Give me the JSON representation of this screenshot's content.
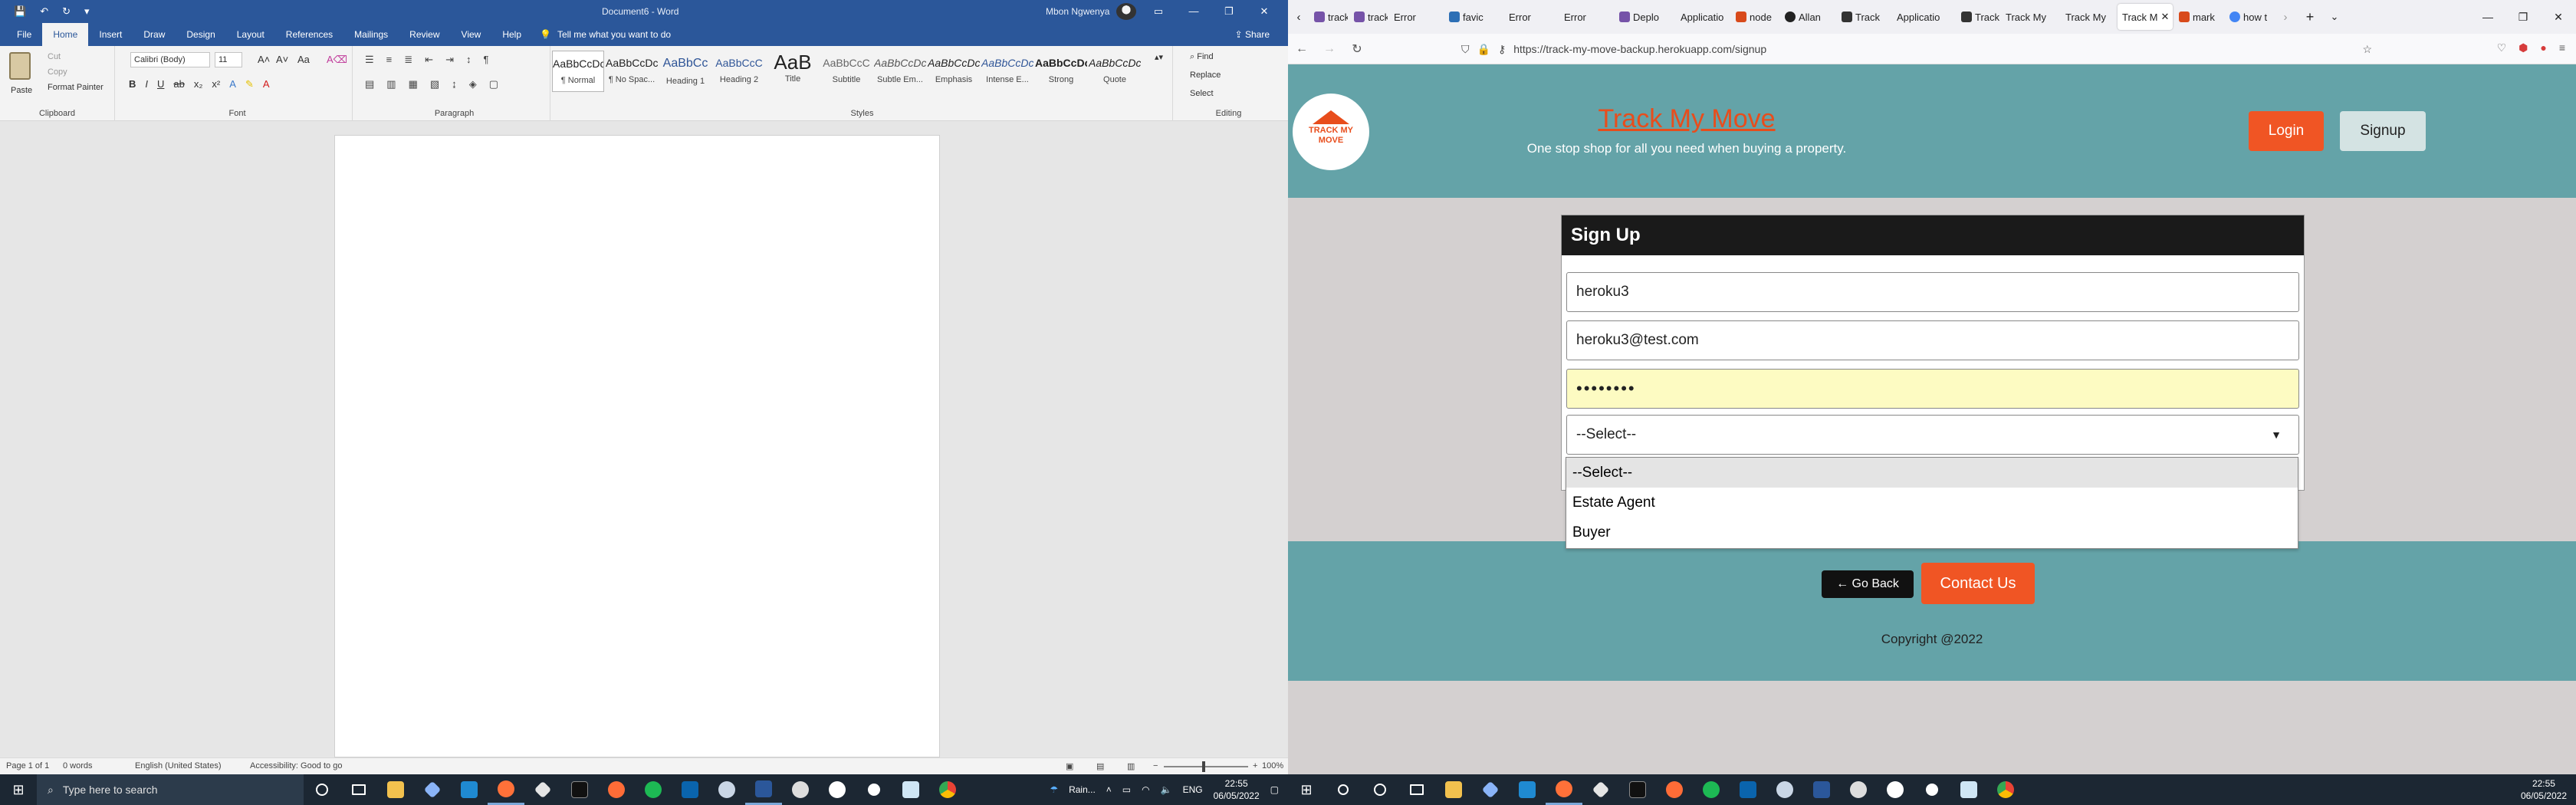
{
  "word": {
    "doc_title": "Document6 - Word",
    "user": "Mbon Ngwenya",
    "tabs": [
      "File",
      "Home",
      "Insert",
      "Draw",
      "Design",
      "Layout",
      "References",
      "Mailings",
      "Review",
      "View",
      "Help"
    ],
    "tell_me": "Tell me what you want to do",
    "share": "Share",
    "clipboard": {
      "paste": "Paste",
      "cut": "Cut",
      "copy": "Copy",
      "format_painter": "Format Painter",
      "label": "Clipboard"
    },
    "font": {
      "name": "Calibri (Body)",
      "size": "11",
      "label": "Font"
    },
    "paragraph_label": "Paragraph",
    "styles": [
      {
        "preview": "AaBbCcDc",
        "name": "¶ Normal"
      },
      {
        "preview": "AaBbCcDc",
        "name": "¶ No Spac..."
      },
      {
        "preview": "AaBbCc",
        "name": "Heading 1"
      },
      {
        "preview": "AaBbCcC",
        "name": "Heading 2"
      },
      {
        "preview": "AaB",
        "name": "Title"
      },
      {
        "preview": "AaBbCcC",
        "name": "Subtitle"
      },
      {
        "preview": "AaBbCcDc",
        "name": "Subtle Em..."
      },
      {
        "preview": "AaBbCcDc",
        "name": "Emphasis"
      },
      {
        "preview": "AaBbCcDc",
        "name": "Intense E..."
      },
      {
        "preview": "AaBbCcDc",
        "name": "Strong"
      },
      {
        "preview": "AaBbCcDc",
        "name": "Quote"
      }
    ],
    "styles_label": "Styles",
    "editing": {
      "find": "Find",
      "replace": "Replace",
      "select": "Select",
      "label": "Editing"
    },
    "status": {
      "page": "Page 1 of 1",
      "words": "0 words",
      "language": "English (United States)",
      "accessibility": "Accessibility: Good to go",
      "zoom": "100%"
    }
  },
  "taskbar_left": {
    "search_placeholder": "Type here to search",
    "weather": "Rain...",
    "lang": "ENG",
    "time": "22:55",
    "date": "06/05/2022"
  },
  "taskbar_right": {
    "time": "22:55",
    "date": "06/05/2022"
  },
  "firefox": {
    "tabs": [
      "track",
      "track",
      "Error",
      "favic",
      "Error",
      "Error",
      "Deplo",
      "Applicatio",
      "node",
      "Allan",
      "Track",
      "Applicatio",
      "Track",
      "Track My",
      "Track My",
      "Track M",
      "mark",
      "how t"
    ],
    "active_tab": 15,
    "url": "https://track-my-move-backup.herokuapp.com/signup"
  },
  "site": {
    "logo_text": [
      "TRACK MY",
      "MOVE"
    ],
    "brand": "Track My Move",
    "tagline": "One stop shop for all you need when buying a property.",
    "login": "Login",
    "signup": "Signup",
    "form": {
      "title": "Sign Up",
      "username": "heroku3",
      "email": "heroku3@test.com",
      "password": "••••••••",
      "select_value": "--Select--",
      "options": [
        "--Select--",
        "Estate Agent",
        "Buyer"
      ]
    },
    "go_back": "← Go Back",
    "contact": "Contact Us",
    "copyright": "Copyright @2022"
  },
  "colors": {
    "word_blue": "#2b579a",
    "teal": "#64a3a8",
    "orange": "#f05524"
  }
}
